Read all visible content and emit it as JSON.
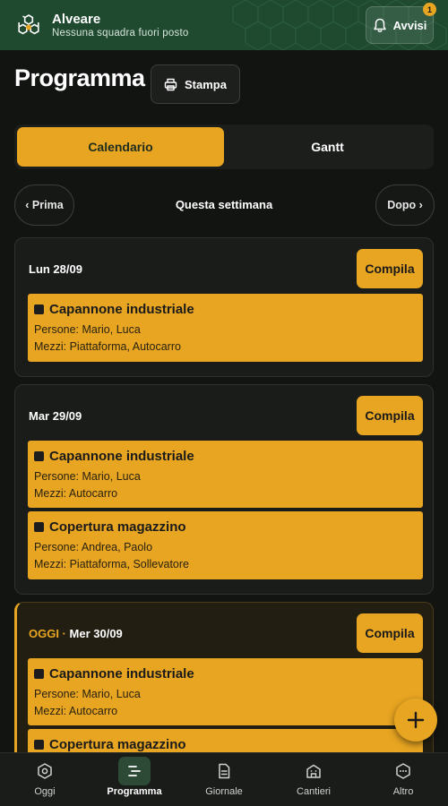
{
  "app": {
    "name": "Alveare",
    "subtitle": "Nessuna squadra fuori posto"
  },
  "alerts": {
    "label": "Avvisi",
    "count": "1"
  },
  "page": {
    "title": "Programma",
    "print_label": "Stampa"
  },
  "tabs": [
    {
      "label": "Calendario",
      "active": true
    },
    {
      "label": "Gantt",
      "active": false
    }
  ],
  "week_nav": {
    "prev_label": "‹ Prima",
    "current_label": "Questa settimana",
    "next_label": "Dopo ›"
  },
  "fill_label": "Compila",
  "days": [
    {
      "label": "Lun 28/09",
      "today": false,
      "jobs": [
        {
          "title": "Capannone industriale",
          "people": "Persone: Mario, Luca",
          "vehicles": "Mezzi: Piattaforma, Autocarro"
        }
      ]
    },
    {
      "label": "Mar 29/09",
      "today": false,
      "jobs": [
        {
          "title": "Capannone industriale",
          "people": "Persone: Mario, Luca",
          "vehicles": "Mezzi: Autocarro"
        },
        {
          "title": "Copertura magazzino",
          "people": "Persone: Andrea, Paolo",
          "vehicles": "Mezzi: Piattaforma, Sollevatore"
        }
      ]
    },
    {
      "today_tag": "OGGI ·",
      "label": "Mer 30/09",
      "today": true,
      "jobs": [
        {
          "title": "Capannone industriale",
          "people": "Persone: Mario, Luca",
          "vehicles": "Mezzi: Autocarro"
        },
        {
          "title": "Copertura magazzino"
        }
      ]
    }
  ],
  "bottom_nav": [
    {
      "label": "Oggi",
      "icon": "hexagon-icon",
      "active": false
    },
    {
      "label": "Programma",
      "icon": "schedule-icon",
      "active": true
    },
    {
      "label": "Giornale",
      "icon": "document-icon",
      "active": false
    },
    {
      "label": "Cantieri",
      "icon": "site-icon",
      "active": false
    },
    {
      "label": "Altro",
      "icon": "more-icon",
      "active": false
    }
  ],
  "colors": {
    "accent": "#e8a521",
    "header": "#1f4a30",
    "background": "#121412"
  }
}
